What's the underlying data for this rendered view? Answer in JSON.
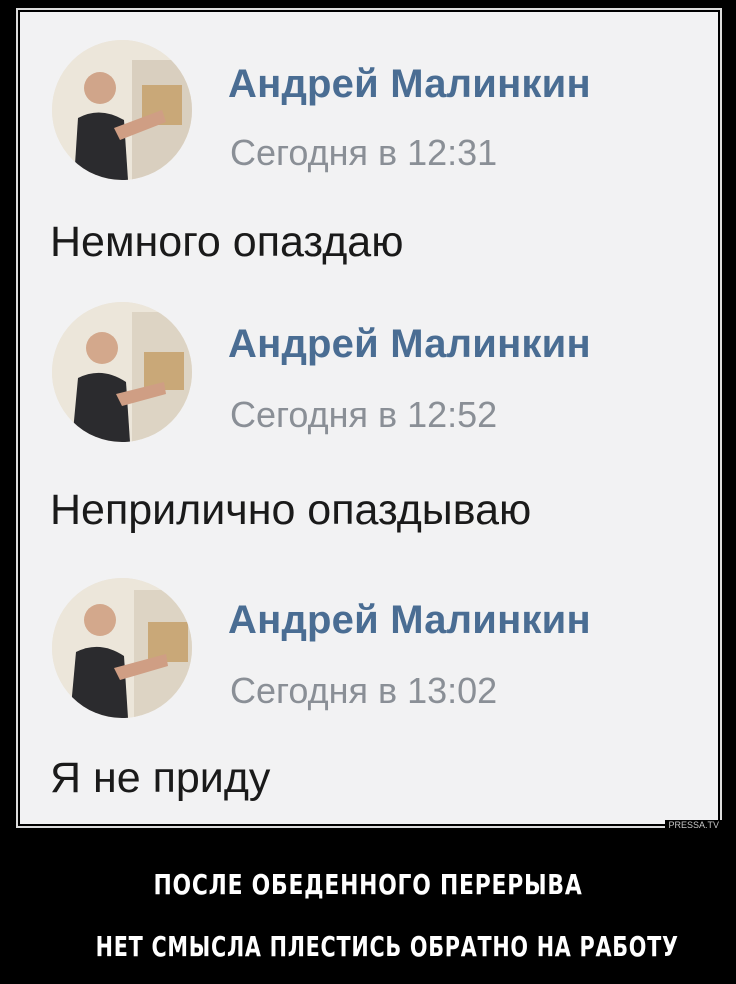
{
  "messages": [
    {
      "author": "Андрей Малинкин",
      "time": "Сегодня в 12:31",
      "text": "Немного опаздаю"
    },
    {
      "author": "Андрей Малинкин",
      "time": "Сегодня в 12:52",
      "text": "Неприлично опаздываю"
    },
    {
      "author": "Андрей Малинкин",
      "time": "Сегодня в 13:02",
      "text": "Я не приду"
    }
  ],
  "watermark": "PRESSA.TV",
  "caption": {
    "line1": "После обеденного перерыва",
    "line2": "нет смысла плестись обратно на работу"
  },
  "colors": {
    "author": "#4a6d93",
    "time": "#8a8f96",
    "text": "#1a1a1a",
    "panel": "#f2f2f3",
    "background": "#000000"
  },
  "icons": [
    "avatar-photo"
  ]
}
